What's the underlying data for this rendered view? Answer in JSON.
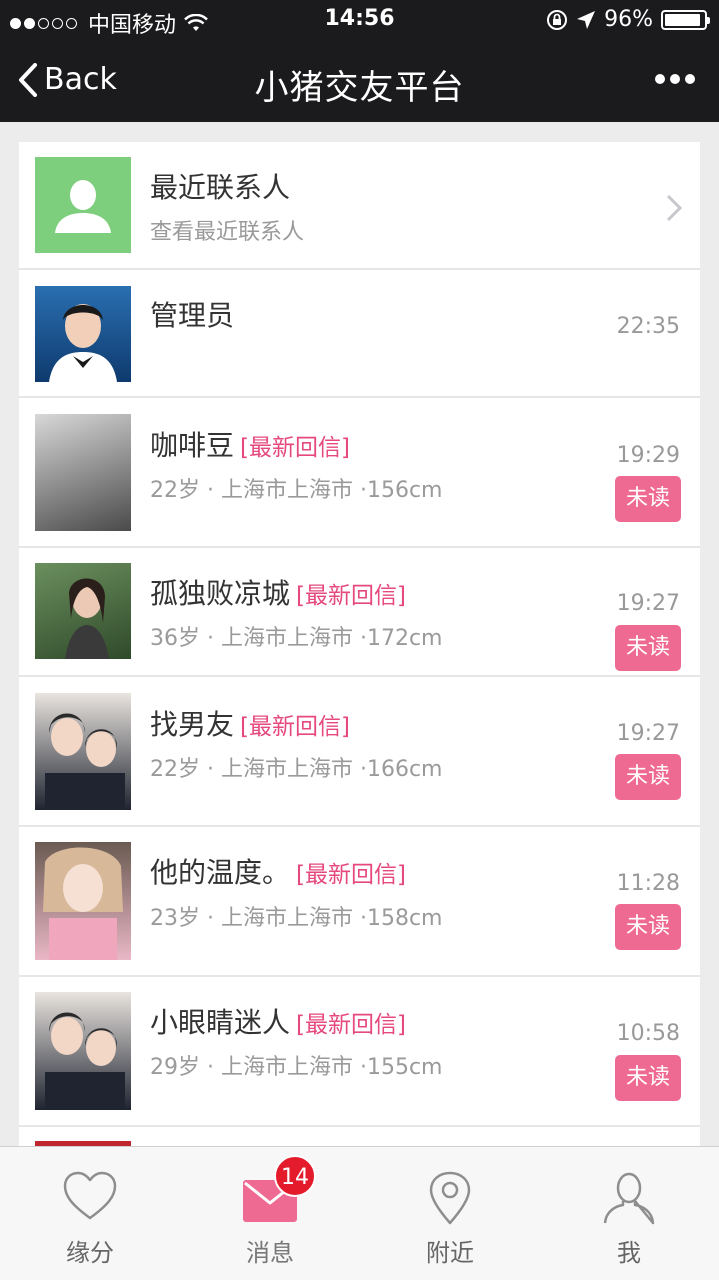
{
  "status_bar": {
    "carrier": "中国移动",
    "time": "14:56",
    "battery": "96%"
  },
  "nav": {
    "back_label": "Back",
    "title": "小猪交友平台"
  },
  "recent_contacts": {
    "title": "最近联系人",
    "subtitle": "查看最近联系人"
  },
  "admin": {
    "name": "管理员",
    "time": "22:35"
  },
  "conversations": [
    {
      "name": "咖啡豆",
      "tag": "[最新回信]",
      "info": "22岁 · 上海市上海市 ·156cm",
      "time": "19:29",
      "status": "未读"
    },
    {
      "name": "孤独败凉城",
      "tag": "[最新回信]",
      "info": "36岁 · 上海市上海市 ·172cm",
      "time": "19:27",
      "status": "未读"
    },
    {
      "name": "找男友",
      "tag": "[最新回信]",
      "info": "22岁 · 上海市上海市 ·166cm",
      "time": "19:27",
      "status": "未读"
    },
    {
      "name": "他的温度。",
      "tag": "[最新回信]",
      "info": "23岁 · 上海市上海市 ·158cm",
      "time": "11:28",
      "status": "未读"
    },
    {
      "name": "小眼睛迷人",
      "tag": "[最新回信]",
      "info": "29岁 · 上海市上海市 ·155cm",
      "time": "10:58",
      "status": "未读"
    }
  ],
  "tabs": [
    {
      "label": "缘分",
      "icon": "heart-icon"
    },
    {
      "label": "消息",
      "icon": "envelope-icon",
      "badge": "14"
    },
    {
      "label": "附近",
      "icon": "location-pin-icon"
    },
    {
      "label": "我",
      "icon": "person-icon"
    }
  ],
  "colors": {
    "bar_bg": "#1b1b1d",
    "accent_pink": "#ef6a93",
    "tag_pink": "#e5497d",
    "contact_green": "#7dcf7d",
    "badge_red": "#e41b2b"
  }
}
